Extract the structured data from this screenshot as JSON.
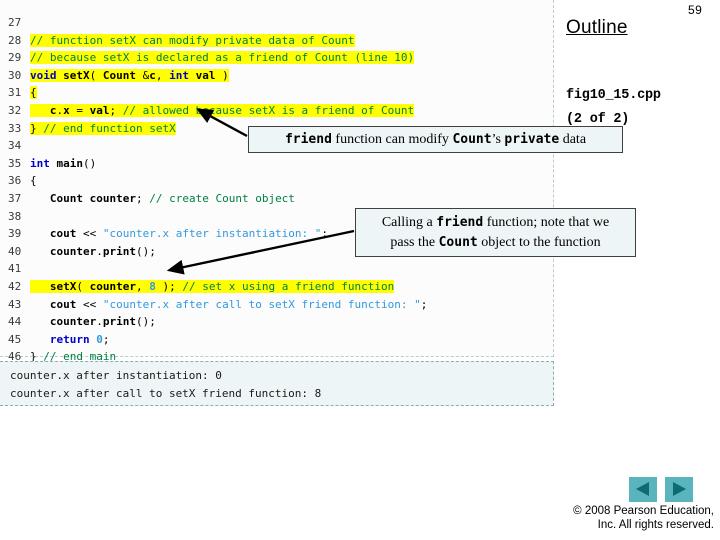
{
  "slide": {
    "page_number": "59",
    "outline_title": "Outline",
    "outline_file": "fig10_15.cpp",
    "outline_file_part": "(2 of 2)"
  },
  "code": {
    "lines": [
      {
        "num": "27",
        "highlight": false,
        "text": ""
      },
      {
        "num": "28",
        "highlight": true,
        "text": "// function setX can modify private data of Count"
      },
      {
        "num": "29",
        "highlight": true,
        "text": "// because setX is declared as a friend of Count (line 10)"
      },
      {
        "num": "30",
        "highlight": true,
        "text": "void setX( Count &c, int val )"
      },
      {
        "num": "31",
        "highlight": true,
        "text": "{"
      },
      {
        "num": "32",
        "highlight": true,
        "text": "   c.x = val; // allowed because setX is a friend of Count"
      },
      {
        "num": "33",
        "highlight": true,
        "text": "} // end function setX"
      },
      {
        "num": "34",
        "highlight": false,
        "text": ""
      },
      {
        "num": "35",
        "highlight": false,
        "text": "int main()"
      },
      {
        "num": "36",
        "highlight": false,
        "text": "{"
      },
      {
        "num": "37",
        "highlight": false,
        "text": "   Count counter; // create Count object"
      },
      {
        "num": "38",
        "highlight": false,
        "text": ""
      },
      {
        "num": "39",
        "highlight": false,
        "text": "   cout << \"counter.x after instantiation: \";"
      },
      {
        "num": "40",
        "highlight": false,
        "text": "   counter.print();"
      },
      {
        "num": "41",
        "highlight": false,
        "text": ""
      },
      {
        "num": "42",
        "highlight": true,
        "text": "   setX( counter, 8 ); // set x using a friend function"
      },
      {
        "num": "43",
        "highlight": false,
        "text": "   cout << \"counter.x after call to setX friend function: \";"
      },
      {
        "num": "44",
        "highlight": false,
        "text": "   counter.print();"
      },
      {
        "num": "45",
        "highlight": false,
        "text": "   return 0;"
      },
      {
        "num": "46",
        "highlight": false,
        "text": "} // end main"
      }
    ]
  },
  "output": {
    "lines": [
      "counter.x after instantiation: 0",
      "counter.x after call to setX friend function: 8"
    ]
  },
  "callouts": {
    "friend_modify": {
      "seg1": "friend",
      "seg2": " function can modify ",
      "seg3": "Count",
      "seg4": "’s ",
      "seg5": "private",
      "seg6": " data"
    },
    "calling_friend": {
      "line1_a": "Calling a ",
      "line1_b": "friend",
      "line1_c": " function; note that we",
      "line2_a": "pass the ",
      "line2_b": "Count",
      "line2_c": " object to the function"
    }
  },
  "nav": {
    "prev_label": "previous-slide",
    "next_label": "next-slide"
  },
  "footer": {
    "line1": "© 2008 Pearson Education,",
    "line2": "Inc.  All rights reserved."
  },
  "colors": {
    "highlight": "#ffff00",
    "keyword": "#0000cc",
    "comment": "#008040",
    "string": "#3399dd",
    "nav_button_bg": "#59b4bd",
    "nav_arrow": "#0d6b77",
    "panel_bg": "#eef5f6"
  }
}
